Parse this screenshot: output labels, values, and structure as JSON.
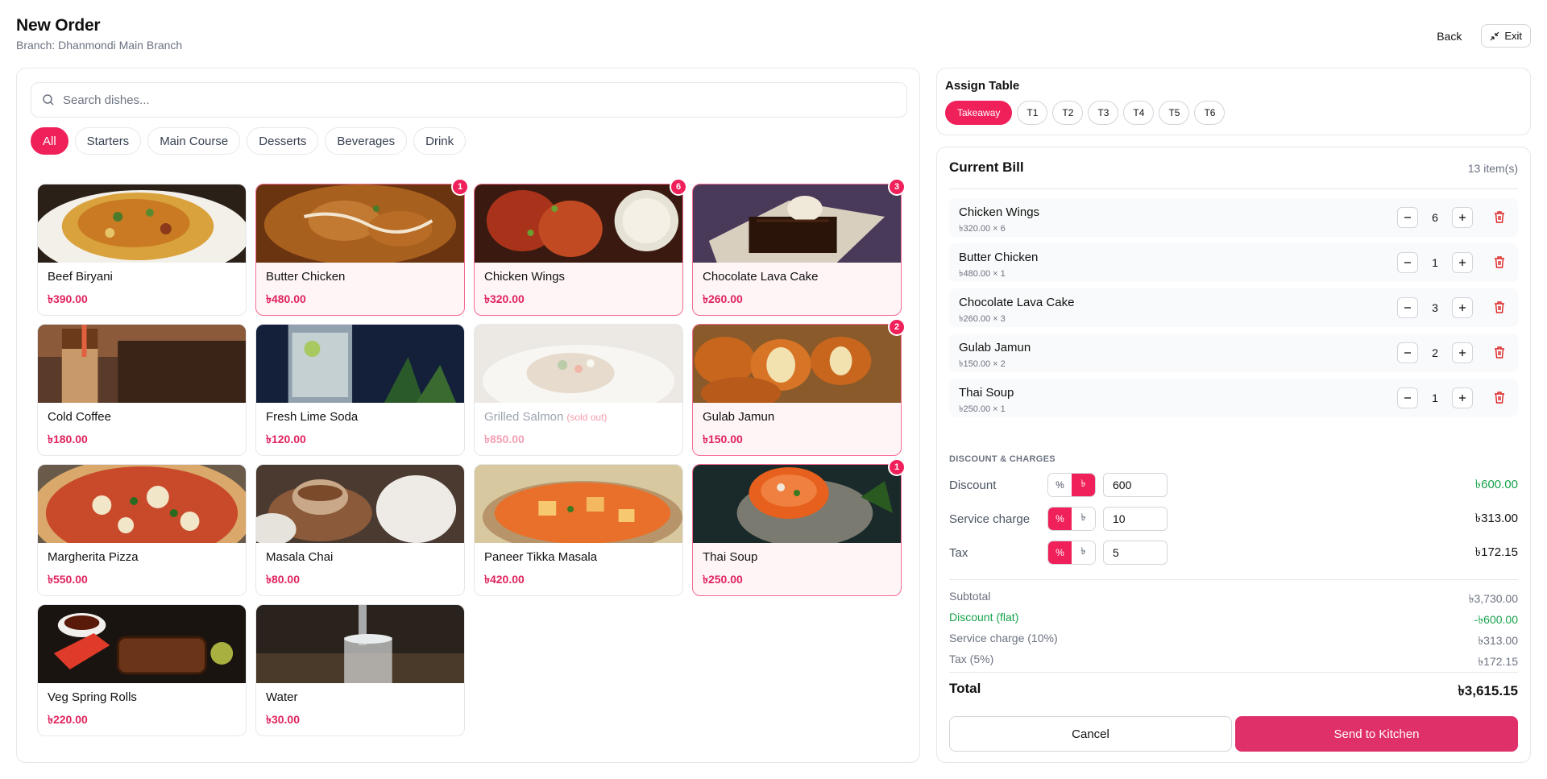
{
  "header": {
    "title": "New Order",
    "branch": "Branch: Dhanmondi Main Branch",
    "back_label": "Back",
    "exit_label": "Exit"
  },
  "menu": {
    "search_placeholder": "Search dishes...",
    "categories": [
      "All",
      "Starters",
      "Main Course",
      "Desserts",
      "Beverages",
      "Drink"
    ],
    "active_category": "All",
    "items": [
      {
        "name": "Beef Biryani",
        "price": "৳390.00",
        "badge": "",
        "sold_out_label": ""
      },
      {
        "name": "Butter Chicken",
        "price": "৳480.00",
        "badge": "1",
        "sold_out_label": ""
      },
      {
        "name": "Chicken Wings",
        "price": "৳320.00",
        "badge": "6",
        "sold_out_label": ""
      },
      {
        "name": "Chocolate Lava Cake",
        "price": "৳260.00",
        "badge": "3",
        "sold_out_label": ""
      },
      {
        "name": "Cold Coffee",
        "price": "৳180.00",
        "badge": "",
        "sold_out_label": ""
      },
      {
        "name": "Fresh Lime Soda",
        "price": "৳120.00",
        "badge": "",
        "sold_out_label": ""
      },
      {
        "name": "Grilled Salmon",
        "price": "৳850.00",
        "badge": "",
        "sold_out_label": "(sold out)"
      },
      {
        "name": "Gulab Jamun",
        "price": "৳150.00",
        "badge": "2",
        "sold_out_label": ""
      },
      {
        "name": "Margherita Pizza",
        "price": "৳550.00",
        "badge": "",
        "sold_out_label": ""
      },
      {
        "name": "Masala Chai",
        "price": "৳80.00",
        "badge": "",
        "sold_out_label": ""
      },
      {
        "name": "Paneer Tikka Masala",
        "price": "৳420.00",
        "badge": "",
        "sold_out_label": ""
      },
      {
        "name": "Thai Soup",
        "price": "৳250.00",
        "badge": "1",
        "sold_out_label": ""
      },
      {
        "name": "Veg Spring Rolls",
        "price": "৳220.00",
        "badge": "",
        "sold_out_label": ""
      },
      {
        "name": "Water",
        "price": "৳30.00",
        "badge": "",
        "sold_out_label": ""
      }
    ]
  },
  "tables": {
    "title": "Assign Table",
    "options": [
      "Takeaway",
      "T1",
      "T2",
      "T3",
      "T4",
      "T5",
      "T6"
    ],
    "selected": "Takeaway"
  },
  "bill": {
    "title": "Current Bill",
    "count": "13 item(s)",
    "items": [
      {
        "name": "Chicken Wings",
        "detail": "৳320.00 × 6",
        "qty": "6"
      },
      {
        "name": "Butter Chicken",
        "detail": "৳480.00 × 1",
        "qty": "1"
      },
      {
        "name": "Chocolate Lava Cake",
        "detail": "৳260.00 × 3",
        "qty": "3"
      },
      {
        "name": "Gulab Jamun",
        "detail": "৳150.00 × 2",
        "qty": "2"
      },
      {
        "name": "Thai Soup",
        "detail": "৳250.00 × 1",
        "qty": "1"
      }
    ],
    "charges_title": "DISCOUNT & CHARGES",
    "charges": [
      {
        "label": "Discount",
        "percent_symbol": "%",
        "flat_symbol": "৳",
        "mode": "flat",
        "value": "600",
        "amount": "৳600.00"
      },
      {
        "label": "Service charge",
        "percent_symbol": "%",
        "flat_symbol": "৳",
        "mode": "percent",
        "value": "10",
        "amount": "৳313.00"
      },
      {
        "label": "Tax",
        "percent_symbol": "%",
        "flat_symbol": "৳",
        "mode": "percent",
        "value": "5",
        "amount": "৳172.15"
      }
    ],
    "summary": {
      "subtotal_label": "Subtotal",
      "subtotal": "৳3,730.00",
      "discount_label": "Discount (flat)",
      "discount": "-৳600.00",
      "service_label": "Service charge (10%)",
      "service": "৳313.00",
      "tax_label": "Tax (5%)",
      "tax": "৳172.15",
      "total_label": "Total",
      "total": "৳3,615.15"
    },
    "cancel_label": "Cancel",
    "send_label": "Send to Kitchen"
  },
  "colors": {
    "accent": "#f0205a",
    "send_button": "#e0306a",
    "discount_green": "#16a34a"
  }
}
